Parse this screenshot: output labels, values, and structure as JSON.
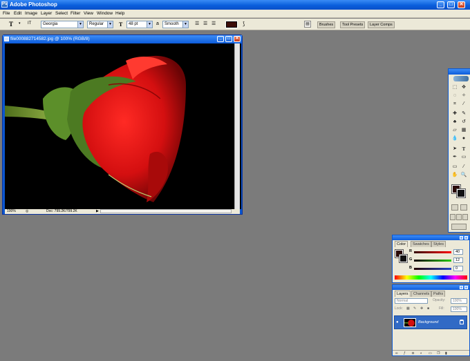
{
  "app": {
    "title": "Adobe Photoshop",
    "icon": "photoshop-app-icon"
  },
  "window_controls": {
    "minimize": "_",
    "maximize": "□",
    "close": "✕"
  },
  "menu": [
    "File",
    "Edit",
    "Image",
    "Layer",
    "Select",
    "Filter",
    "View",
    "Window",
    "Help"
  ],
  "options_bar": {
    "tool_glyph": "T",
    "orient_glyph": "IT",
    "font_family": "Georgia",
    "font_style": "Regular",
    "size_glyph": "T",
    "font_size": "48 pt",
    "aa_glyph": "a",
    "antialias": "Smooth",
    "text_color": "#3c0d08",
    "palette_tabs": [
      "Brushes",
      "Tool Presets",
      "Layer Comps"
    ]
  },
  "document": {
    "title": "file000882714582.jpg @ 100% (RGB/8)",
    "zoom": "100%",
    "doc_size": "Doc: 799.2K/799.2K"
  },
  "toolbox": {
    "fg_color": "#2a0a06",
    "bg_color": "#111111"
  },
  "color_palette": {
    "tabs": [
      "Color",
      "Swatches",
      "Styles"
    ],
    "channels": [
      {
        "label": "R",
        "value": "40",
        "color": "#e03020"
      },
      {
        "label": "G",
        "value": "12",
        "color": "#20a030"
      },
      {
        "label": "B",
        "value": "0",
        "color": "#2030c0"
      }
    ]
  },
  "layers_palette": {
    "tabs": [
      "Layers",
      "Channels",
      "Paths"
    ],
    "blend_mode": "Normal",
    "opacity_label": "Opacity:",
    "opacity": "100%",
    "lock_label": "Lock:",
    "fill_label": "Fill:",
    "fill": "100%",
    "layer_name": "Background"
  }
}
